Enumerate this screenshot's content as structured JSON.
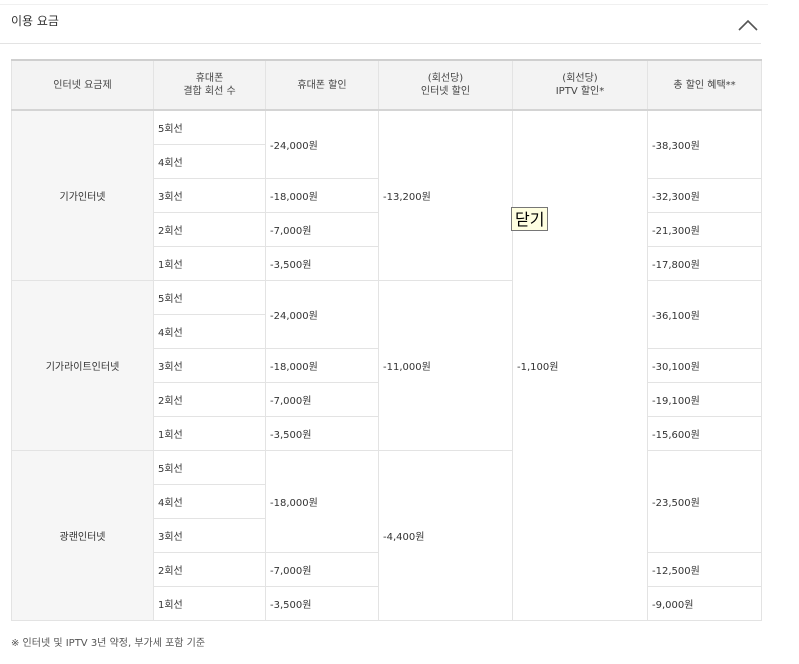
{
  "section": {
    "title": "이용 요금"
  },
  "tooltip": {
    "label": "닫기"
  },
  "table": {
    "headers": {
      "plan": "인터넷 요금제",
      "lines_1": "휴대폰",
      "lines_2": "결합 회선 수",
      "phone_discount": "휴대폰 할인",
      "internet_1": "(회선당)",
      "internet_2": "인터넷 할인",
      "iptv_1": "(회선당)",
      "iptv_2": "IPTV 할인*",
      "total": "총 할인 혜택**"
    },
    "iptv_discount": "-1,100원",
    "groups": [
      {
        "plan": "기가인터넷",
        "internet_discount": "-13,200원",
        "rows": [
          {
            "lines": "5회선",
            "phone": "-24,000원",
            "total": "-38,300원"
          },
          {
            "lines": "4회선"
          },
          {
            "lines": "3회선",
            "phone": "-18,000원",
            "total": "-32,300원"
          },
          {
            "lines": "2회선",
            "phone": "-7,000원",
            "total": "-21,300원"
          },
          {
            "lines": "1회선",
            "phone": "-3,500원",
            "total": "-17,800원"
          }
        ]
      },
      {
        "plan": "기가라이트인터넷",
        "internet_discount": "-11,000원",
        "rows": [
          {
            "lines": "5회선",
            "phone": "-24,000원",
            "total": "-36,100원"
          },
          {
            "lines": "4회선"
          },
          {
            "lines": "3회선",
            "phone": "-18,000원",
            "total": "-30,100원"
          },
          {
            "lines": "2회선",
            "phone": "-7,000원",
            "total": "-19,100원"
          },
          {
            "lines": "1회선",
            "phone": "-3,500원",
            "total": "-15,600원"
          }
        ]
      },
      {
        "plan": "광랜인터넷",
        "internet_discount": "-4,400원",
        "rows": [
          {
            "lines": "5회선",
            "phone": "-18,000원",
            "total": "-23,500원"
          },
          {
            "lines": "4회선"
          },
          {
            "lines": "3회선"
          },
          {
            "lines": "2회선",
            "phone": "-7,000원",
            "total": "-12,500원"
          },
          {
            "lines": "1회선",
            "phone": "-3,500원",
            "total": "-9,000원"
          }
        ]
      }
    ]
  },
  "footnote": "※ 인터넷 및 IPTV 3년 약정, 부가세 포함 기준"
}
